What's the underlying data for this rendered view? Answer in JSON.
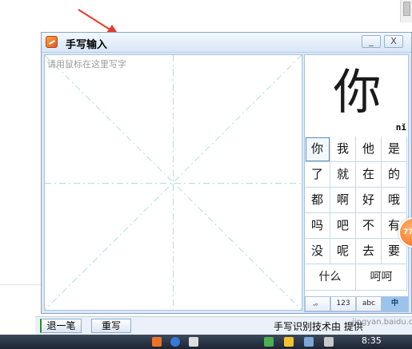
{
  "window": {
    "title": "手写输入",
    "minimize_label": "_",
    "close_label": "X"
  },
  "pad": {
    "hint": "请用鼠标在这里写字"
  },
  "recognition": {
    "big_char": "你",
    "pinyin": "nǐ"
  },
  "candidates": [
    [
      "你",
      "我",
      "他",
      "是"
    ],
    [
      "了",
      "就",
      "在",
      "的"
    ],
    [
      "都",
      "啊",
      "好",
      "哦"
    ],
    [
      "吗",
      "吧",
      "不",
      "有"
    ],
    [
      "没",
      "呢",
      "去",
      "要"
    ]
  ],
  "words": [
    "什么",
    "呵呵"
  ],
  "modes": [
    ",。",
    "123",
    "abc",
    "中"
  ],
  "toolbar": {
    "undo_label": "退一笔",
    "rewrite_label": "重写",
    "credit": "手写识别技术由   提供",
    "watermark": "jingyan.baidu.com"
  },
  "taskbar": {
    "clock": "8:35"
  },
  "colors": {
    "window_bg": "#dbe8f6",
    "guide_line": "#b5dcdc",
    "active_mode": "#9cc3eb",
    "arrow": "#e53a2e"
  }
}
